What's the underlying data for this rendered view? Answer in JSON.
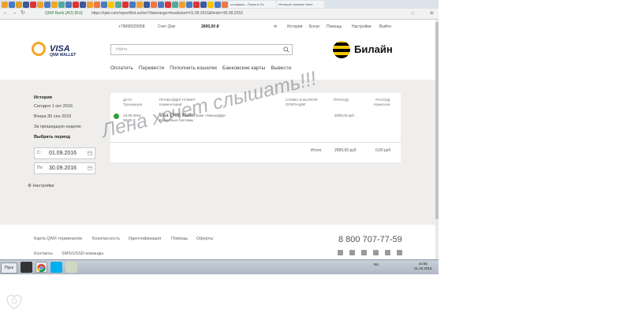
{
  "browser": {
    "tabs": [
      {
        "title": "кредитная карта"
      },
      {
        "title": "кл.афиша - Поиск в Go"
      },
      {
        "title": "Интернет магазин биле"
      }
    ],
    "secure_label": "QIWI Bank (AO) [RU]",
    "url": "https://qiwi.com/report/list.action?daterange=true&start=01.09.2016&finish=30.09.2016"
  },
  "header": {
    "phone": "+79095529958",
    "account_label": "Счет Qiwi",
    "balance": "2600,00 ₽",
    "links": [
      "История",
      "Бонус",
      "Помощь",
      "Настройки",
      "Выйти"
    ]
  },
  "logo": {
    "brand": "VISA",
    "sub": "QIWI WALLET"
  },
  "search": {
    "placeholder": "Найти"
  },
  "partner": {
    "name": "Билайн"
  },
  "nav": [
    "Оплатить",
    "Перевести",
    "Пополнить кошелек",
    "Банковские карты",
    "Вывести"
  ],
  "sidebar": {
    "title": "История",
    "items": [
      "Сегодня 1 окт 2016",
      "Вчера 30 сен 2016",
      "За прошедшую неделю"
    ],
    "period_title": "Выбрать период",
    "from_label": "С:",
    "from_value": "01.09.2016",
    "to_label": "По:",
    "to_value": "30.09.2016",
    "settings": "Настройки"
  },
  "table": {
    "headers": {
      "date": "ДАТА",
      "transaction": "Транзакция",
      "provider": "ПРОВАЙДЕР НОМЕР",
      "comment": "Комментарий",
      "sum": "СУММА В ВАЛЮТЕ ОПЕРАЦИИ",
      "income": "ПРИХОД",
      "expense": "РАСХОД",
      "commission": "Комиссия"
    },
    "row": {
      "date": "13.09.2016",
      "time": "09:00",
      "provider": "Visa QIWI Wallet",
      "bank": "Банк «Тинькофф»",
      "comment": "Кредитные Системы",
      "income": "2000,00 руб."
    },
    "total_label": "Итого:",
    "total_income": "2000,00 руб",
    "total_expense": "0,00 руб"
  },
  "watermark": "Лена хочет слышать!!!",
  "footer": {
    "links_row1": [
      "Карта QIWI терминалов",
      "Безопасность",
      "Идентификация",
      "Помощь",
      "Оферты"
    ],
    "links_row2": [
      "Контакты",
      "SMS/USSD-команды"
    ],
    "phone": "8 800 707-77-59"
  },
  "taskbar": {
    "start": "Пуск",
    "tray": "RU",
    "time": "15:55",
    "date": "01.10.2016"
  },
  "colors": {
    "qiwi_orange": "#f5a623",
    "visa_navy": "#1a2a5e",
    "beeline_yellow": "#f7c600",
    "success_green": "#2e9e3a"
  }
}
